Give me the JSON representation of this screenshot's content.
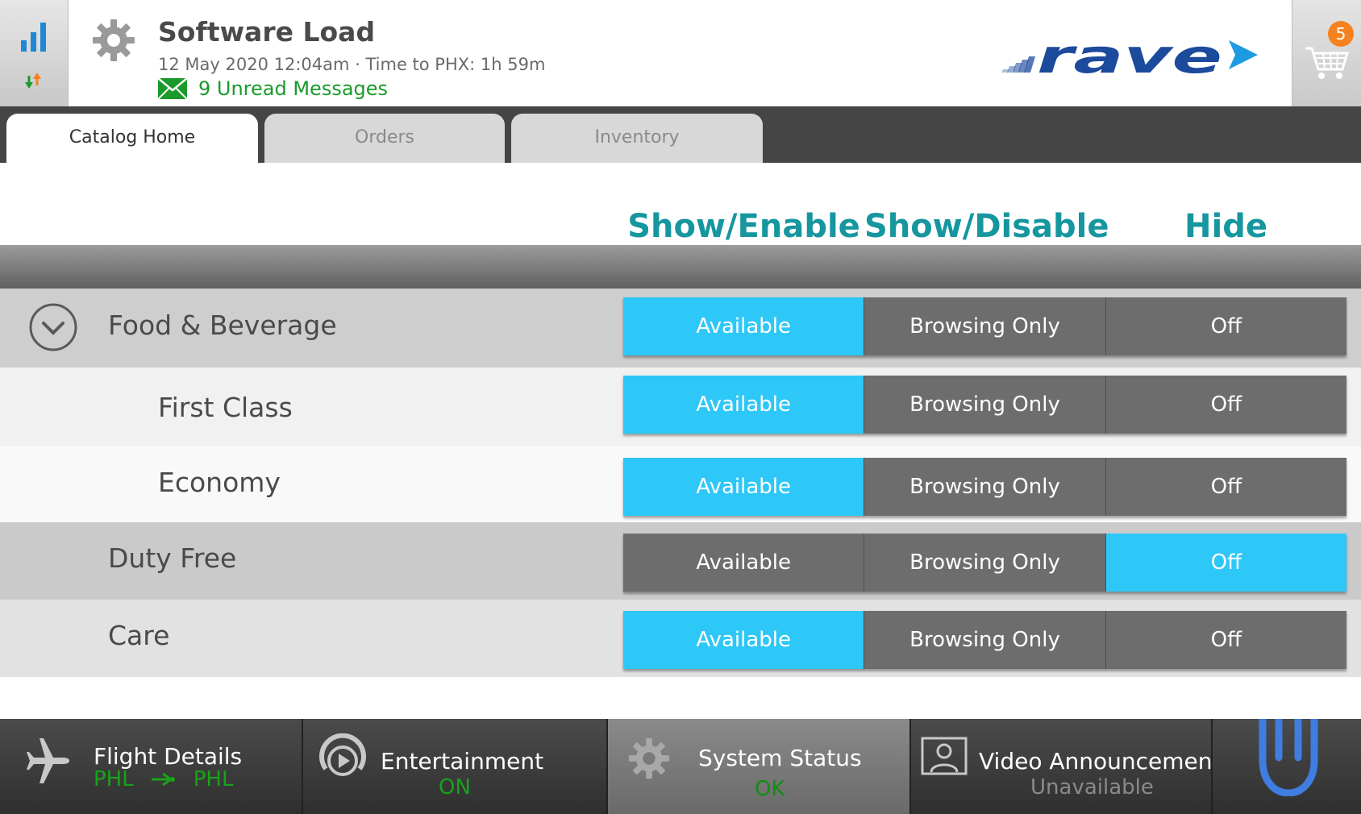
{
  "header": {
    "title": "Software Load",
    "flight_info": "12 May 2020 12:04am · Time to PHX: 1h 59m",
    "messages": "9 Unread Messages",
    "cart_count": "5",
    "logo_text": "rave"
  },
  "tabs": [
    {
      "label": "Catalog Home",
      "active": true
    },
    {
      "label": "Orders",
      "active": false
    },
    {
      "label": "Inventory",
      "active": false
    }
  ],
  "columns": {
    "show_enable": "Show/Enable",
    "show_disable": "Show/Disable",
    "hide": "Hide"
  },
  "options": {
    "available": "Available",
    "browsing": "Browsing Only",
    "off": "Off"
  },
  "rows": [
    {
      "label": "Food & Beverage",
      "selected": "Available"
    },
    {
      "label": "First Class",
      "selected": "Available"
    },
    {
      "label": "Economy",
      "selected": "Available"
    },
    {
      "label": "Duty Free",
      "selected": "Off"
    },
    {
      "label": "Care",
      "selected": "Available"
    }
  ],
  "bottom": {
    "flight": {
      "title": "Flight Details",
      "origin": "PHL",
      "destination": "PHL"
    },
    "entertainment": {
      "title": "Entertainment",
      "status": "ON"
    },
    "system": {
      "title": "System Status",
      "status": "OK"
    },
    "video": {
      "title": "Video Announcements",
      "status": "Unavailable"
    }
  },
  "colors": {
    "accent": "#2dc7f8",
    "header_teal": "#16969f",
    "ok_green": "#18a21a",
    "badge_orange": "#f5821f",
    "logo_blue": "#1c4a9c"
  }
}
